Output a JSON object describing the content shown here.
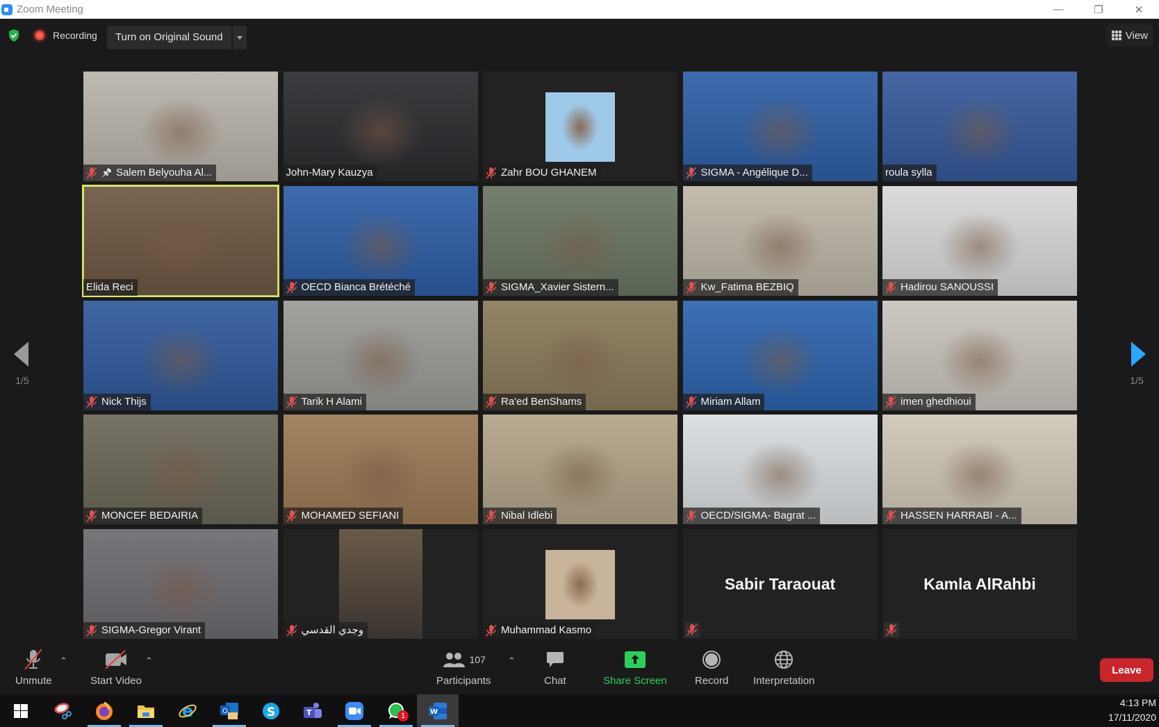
{
  "window": {
    "title": "Zoom Meeting",
    "minimize": "—",
    "restore": "❐",
    "close": "✕"
  },
  "topbar": {
    "security_icon": "shield-check-icon",
    "recording_label": "Recording",
    "original_sound_label": "Turn on Original Sound",
    "view_label": "View"
  },
  "gallery": {
    "page_indicator_prev": "1/5",
    "page_indicator_next": "1/5",
    "tiles": [
      {
        "name": "Salem Belyouha Al...",
        "muted": true,
        "pinned": true,
        "bg": "#b9b4ab",
        "active": false,
        "type": "video"
      },
      {
        "name": "John-Mary Kauzya",
        "muted": false,
        "pinned": false,
        "bg": "#2c2c30",
        "active": false,
        "type": "video"
      },
      {
        "name": "Zahr BOU GHANEM",
        "muted": true,
        "pinned": false,
        "bg": "#222222",
        "active": false,
        "type": "photo",
        "photo_bg": "#9fc9e8"
      },
      {
        "name": "SIGMA - Angélique D...",
        "muted": true,
        "pinned": false,
        "bg": "#2f5fa7",
        "active": false,
        "type": "video"
      },
      {
        "name": "roula sylla",
        "muted": false,
        "pinned": false,
        "bg": "#36599a",
        "active": false,
        "type": "video"
      },
      {
        "name": "Elida Reci",
        "muted": false,
        "pinned": false,
        "bg": "#6e5742",
        "active": true,
        "type": "video"
      },
      {
        "name": "OECD Bianca Brétéché",
        "muted": true,
        "pinned": false,
        "bg": "#2e5da5",
        "active": false,
        "type": "video"
      },
      {
        "name": "SIGMA_Xavier Sistern...",
        "muted": true,
        "pinned": false,
        "bg": "#6a7563",
        "active": false,
        "type": "video"
      },
      {
        "name": "Kw_Fatima BEZBIQ",
        "muted": true,
        "pinned": false,
        "bg": "#bdb6a8",
        "active": false,
        "type": "video"
      },
      {
        "name": "Hadirou SANOUSSI",
        "muted": true,
        "pinned": false,
        "bg": "#d8d8d8",
        "active": false,
        "type": "video"
      },
      {
        "name": "Nick Thijs",
        "muted": true,
        "pinned": false,
        "bg": "#30599b",
        "active": false,
        "type": "video"
      },
      {
        "name": "Tarik H Alami",
        "muted": true,
        "pinned": false,
        "bg": "#9a9a96",
        "active": false,
        "type": "video"
      },
      {
        "name": "Ra'ed BenShams",
        "muted": true,
        "pinned": false,
        "bg": "#8a7a5a",
        "active": false,
        "type": "video"
      },
      {
        "name": "Miriam Allam",
        "muted": true,
        "pinned": false,
        "bg": "#2d64ae",
        "active": false,
        "type": "video"
      },
      {
        "name": "imen ghedhioui",
        "muted": true,
        "pinned": false,
        "bg": "#c9c4bd",
        "active": false,
        "type": "video"
      },
      {
        "name": "MONCEF BEDAIRIA",
        "muted": true,
        "pinned": false,
        "bg": "#6b6658",
        "active": false,
        "type": "video"
      },
      {
        "name": "MOHAMED SEFIANI",
        "muted": true,
        "pinned": false,
        "bg": "#9b7a55",
        "active": false,
        "type": "video"
      },
      {
        "name": "Nibal Idlebi",
        "muted": true,
        "pinned": false,
        "bg": "#b3a488",
        "active": false,
        "type": "video"
      },
      {
        "name": "OECD/SIGMA- Bagrat ...",
        "muted": true,
        "pinned": false,
        "bg": "#d9dde0",
        "active": false,
        "type": "video"
      },
      {
        "name": "HASSEN HARRABI - A...",
        "muted": true,
        "pinned": false,
        "bg": "#cfc7b8",
        "active": false,
        "type": "video"
      },
      {
        "name": "SIGMA-Gregor Virant",
        "muted": true,
        "pinned": false,
        "bg": "#6d6a70",
        "active": false,
        "type": "video"
      },
      {
        "name": "وجدي القدسي",
        "muted": true,
        "pinned": false,
        "bg": "#222222",
        "active": false,
        "type": "video-narrow"
      },
      {
        "name": "Muhammad Kasmo",
        "muted": true,
        "pinned": false,
        "bg": "#222222",
        "active": false,
        "type": "photo",
        "photo_bg": "#c8b49a"
      },
      {
        "name": "Sabir Taraouat",
        "muted": true,
        "pinned": false,
        "bg": "#222222",
        "active": false,
        "type": "name-only"
      },
      {
        "name": "Kamla AlRahbi",
        "muted": true,
        "pinned": false,
        "bg": "#222222",
        "active": false,
        "type": "name-only"
      }
    ]
  },
  "toolbar": {
    "unmute_label": "Unmute",
    "start_video_label": "Start Video",
    "participants_label": "Participants",
    "participants_count": "107",
    "chat_label": "Chat",
    "share_screen_label": "Share Screen",
    "record_label": "Record",
    "interpretation_label": "Interpretation",
    "leave_label": "Leave",
    "share_color": "#2ccf5a",
    "leave_color": "#c9262c"
  },
  "taskbar": {
    "apps": [
      {
        "name": "start-menu",
        "running": false
      },
      {
        "name": "snipping-tool",
        "running": false
      },
      {
        "name": "firefox",
        "running": true
      },
      {
        "name": "file-explorer",
        "running": true
      },
      {
        "name": "internet-explorer",
        "running": false
      },
      {
        "name": "outlook",
        "running": true
      },
      {
        "name": "skype",
        "running": false
      },
      {
        "name": "teams",
        "running": false
      },
      {
        "name": "zoom",
        "running": true
      },
      {
        "name": "whatsapp",
        "running": true,
        "badge": "1"
      },
      {
        "name": "word",
        "running": true,
        "focused": true
      }
    ],
    "time": "4:13 PM",
    "date": "17/11/2020"
  }
}
